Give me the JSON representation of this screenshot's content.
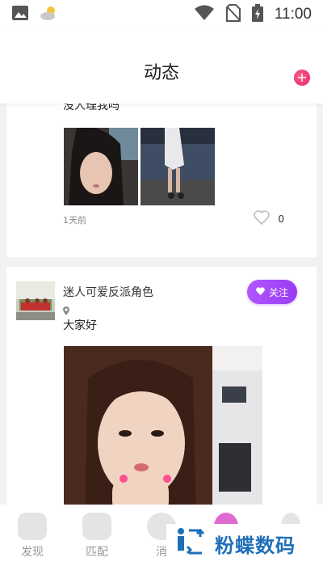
{
  "status_bar": {
    "time": "11:00",
    "left_icons": [
      "image-icon",
      "weather-icon"
    ],
    "right_icons": [
      "wifi-icon",
      "no-sim-icon",
      "battery-icon"
    ]
  },
  "header": {
    "title": "动态",
    "add_icon": "plus-icon"
  },
  "posts": [
    {
      "username": "",
      "content": "没人理我吗",
      "time": "1天前",
      "likes": "0",
      "follow_label": ""
    },
    {
      "username": "迷人可爱反派角色",
      "content": "大家好",
      "follow_label": "关注"
    }
  ],
  "nav": [
    {
      "label": "发现",
      "icon": "home-icon"
    },
    {
      "label": "匹配",
      "icon": "heart-match-icon"
    },
    {
      "label": "消",
      "icon": "message-icon"
    },
    {
      "label": "",
      "icon": "feed-icon"
    },
    {
      "label": "",
      "icon": "profile-icon"
    }
  ],
  "watermark": {
    "text": "粉蝶数码"
  },
  "colors": {
    "accent": "#9a3bf2",
    "plus": "#e0246a",
    "watermark": "#1e6fb8"
  }
}
